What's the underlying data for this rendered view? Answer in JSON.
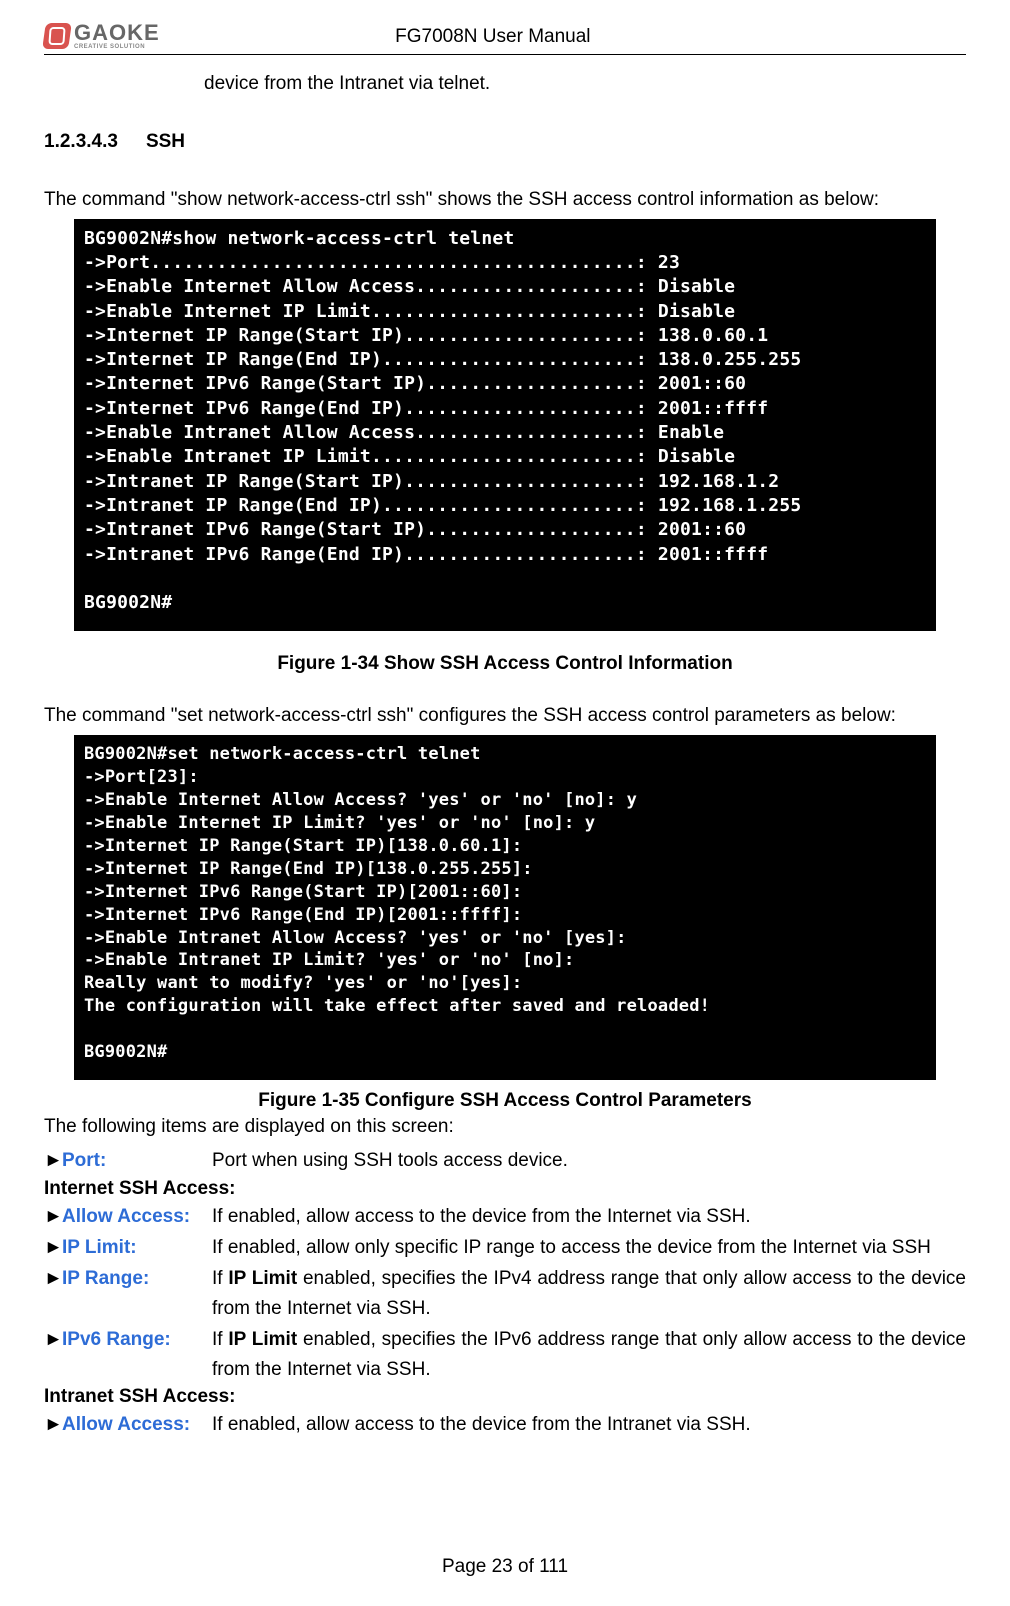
{
  "header": {
    "logo_main": "GAOKE",
    "logo_sub": "CREATIVE SOLUTION",
    "title": "FG7008N User Manual"
  },
  "continuation_text": "device from the Intranet via telnet.",
  "section": {
    "number": "1.2.3.4.3",
    "title": "SSH"
  },
  "para_show": "The command \"show network-access-ctrl ssh\" shows the SSH access control information as below:",
  "terminal_show": "BG9002N#show network-access-ctrl telnet\n->Port............................................: 23\n->Enable Internet Allow Access....................: Disable\n->Enable Internet IP Limit........................: Disable\n->Internet IP Range(Start IP).....................: 138.0.60.1\n->Internet IP Range(End IP).......................: 138.0.255.255\n->Internet IPv6 Range(Start IP)...................: 2001::60\n->Internet IPv6 Range(End IP).....................: 2001::ffff\n->Enable Intranet Allow Access....................: Enable\n->Enable Intranet IP Limit........................: Disable\n->Intranet IP Range(Start IP).....................: 192.168.1.2\n->Intranet IP Range(End IP).......................: 192.168.1.255\n->Intranet IPv6 Range(Start IP)...................: 2001::60\n->Intranet IPv6 Range(End IP).....................: 2001::ffff\n\nBG9002N#",
  "fig_show": "Figure 1-34   Show SSH Access Control Information",
  "para_set": "The command \"set network-access-ctrl ssh\" configures the SSH access control parameters as below:",
  "terminal_set": "BG9002N#set network-access-ctrl telnet\n->Port[23]:\n->Enable Internet Allow Access? 'yes' or 'no' [no]: y\n->Enable Internet IP Limit? 'yes' or 'no' [no]: y\n->Internet IP Range(Start IP)[138.0.60.1]:\n->Internet IP Range(End IP)[138.0.255.255]:\n->Internet IPv6 Range(Start IP)[2001::60]:\n->Internet IPv6 Range(End IP)[2001::ffff]:\n->Enable Intranet Allow Access? 'yes' or 'no' [yes]:\n->Enable Intranet IP Limit? 'yes' or 'no' [no]:\nReally want to modify? 'yes' or 'no'[yes]:\nThe configuration will take effect after saved and reloaded!\n\nBG9002N#",
  "fig_set": "Figure 1-35   Configure SSH Access Control Parameters",
  "items_intro": "The following items are displayed on this screen:",
  "arrow": "►",
  "items": {
    "port": {
      "label": "Port:",
      "desc": "Port when using SSH tools access device."
    },
    "internet_hdr": "Internet SSH Access:",
    "allow_i": {
      "label": "Allow Access:",
      "desc": "If enabled, allow access to the device from the Internet via SSH."
    },
    "iplimit_i": {
      "label": "IP Limit:",
      "desc": "If enabled, allow only specific IP range to access the device from the Internet via SSH"
    },
    "iprange_i": {
      "label": "IP Range:",
      "desc_pre": "If ",
      "desc_bold": "IP Limit",
      "desc_post": " enabled, specifies the IPv4 address range that only allow access to the device from the Internet via SSH."
    },
    "ip6range_i": {
      "label": "IPv6 Range:",
      "desc_pre": "If ",
      "desc_bold": "IP Limit",
      "desc_post": " enabled, specifies the IPv6 address range that only allow access to the device from the Internet via SSH."
    },
    "intranet_hdr": "Intranet SSH Access:",
    "allow_n": {
      "label": "Allow Access:",
      "desc": "If enabled, allow access to the device from the Intranet via SSH."
    }
  },
  "footer": "Page 23 of 111"
}
